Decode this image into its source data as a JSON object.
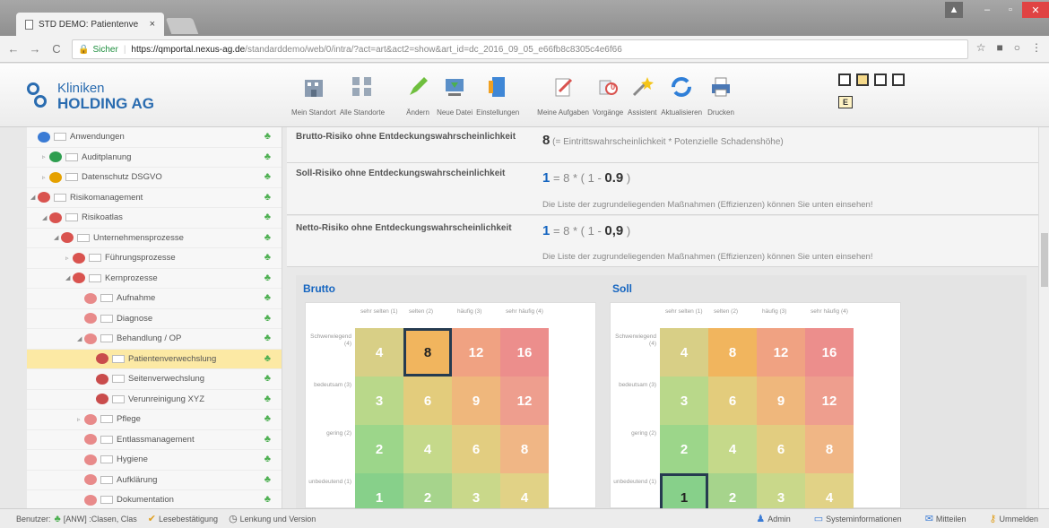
{
  "browser": {
    "tab_title": "STD DEMO: Patientenve",
    "tab_close": "×",
    "secure_label": "Sicher",
    "url_host": "https://qmportal.nexus-ag.de",
    "url_path": "/standarddemo/web/0/intra/?act=art&act2=show&art_id=dc_2016_09_05_e66fb8c8305c4e6f66"
  },
  "logo": {
    "line1": "Kliniken",
    "line2": "HOLDING AG"
  },
  "toolbar": {
    "mein_standort": "Mein Standort",
    "alle_standorte": "Alle Standorte",
    "aendern": "Ändern",
    "neue_datei": "Neue Datei",
    "einstellungen": "Einstellungen",
    "meine_aufgaben": "Meine Aufgaben",
    "vorgaenge": "Vorgänge",
    "vorgaenge_badge": "0",
    "assistent": "Assistent",
    "aktualisieren": "Aktualisieren",
    "drucken": "Drucken",
    "view_e": "E"
  },
  "sidebar": {
    "items": [
      {
        "label": "Anwendungen",
        "indent": 0,
        "tri": "",
        "icon": "#3a7bd5"
      },
      {
        "label": "Auditplanung",
        "indent": 1,
        "tri": "▹",
        "icon": "#2e9e4f"
      },
      {
        "label": "Datenschutz DSGVO",
        "indent": 1,
        "tri": "▹",
        "icon": "#e5a100"
      },
      {
        "label": "Risikomanagement",
        "indent": 0,
        "tri": "◢",
        "icon": "#d9534f"
      },
      {
        "label": "Risikoatlas",
        "indent": 1,
        "tri": "◢",
        "icon": "#d9534f"
      },
      {
        "label": "Unternehmensprozesse",
        "indent": 2,
        "tri": "◢",
        "icon": "#d9534f"
      },
      {
        "label": "Führungsprozesse",
        "indent": 3,
        "tri": "▹",
        "icon": "#d9534f"
      },
      {
        "label": "Kernprozesse",
        "indent": 3,
        "tri": "◢",
        "icon": "#d9534f"
      },
      {
        "label": "Aufnahme",
        "indent": 4,
        "tri": "",
        "icon": "#e88a8a"
      },
      {
        "label": "Diagnose",
        "indent": 4,
        "tri": "",
        "icon": "#e88a8a"
      },
      {
        "label": "Behandlung / OP",
        "indent": 4,
        "tri": "◢",
        "icon": "#e88a8a"
      },
      {
        "label": "Patientenverwechslung",
        "indent": 5,
        "tri": "",
        "icon": "#c94c4c",
        "selected": true
      },
      {
        "label": "Seitenverwechslung",
        "indent": 5,
        "tri": "",
        "icon": "#c94c4c"
      },
      {
        "label": "Verunreinigung XYZ",
        "indent": 5,
        "tri": "",
        "icon": "#c94c4c"
      },
      {
        "label": "Pflege",
        "indent": 4,
        "tri": "▹",
        "icon": "#e88a8a"
      },
      {
        "label": "Entlassmanagement",
        "indent": 4,
        "tri": "",
        "icon": "#e88a8a"
      },
      {
        "label": "Hygiene",
        "indent": 4,
        "tri": "",
        "icon": "#e88a8a"
      },
      {
        "label": "Aufklärung",
        "indent": 4,
        "tri": "",
        "icon": "#e88a8a"
      },
      {
        "label": "Dokumentation",
        "indent": 4,
        "tri": "",
        "icon": "#e88a8a"
      }
    ]
  },
  "risk": {
    "brutto_label": "Brutto-Risiko ohne Entdeckungswahrscheinlichkeit",
    "brutto_value": "8",
    "brutto_formula": "(= Eintrittswahrscheinlichkeit * Potenzielle Schadenshöhe)",
    "soll_label": "Soll-Risiko ohne Entdeckungswahrscheinlichkeit",
    "soll_value": "1",
    "soll_formula_a": " = 8 * ( 1 - ",
    "soll_factor": "0.9",
    "soll_formula_b": " )",
    "soll_note": "Die Liste der zugrundeliegenden Maßnahmen (Effizienzen) können Sie unten einsehen!",
    "netto_label": "Netto-Risiko ohne Entdeckungswahrscheinlichkeit",
    "netto_value": "1",
    "netto_formula_a": " = 8 * ( 1 - ",
    "netto_factor": "0,9",
    "netto_formula_b": " )",
    "netto_note": "Die Liste der zugrundeliegenden Maßnahmen (Effizienzen) können Sie unten einsehen!"
  },
  "matrix": {
    "brutto_title": "Brutto",
    "soll_title": "Soll",
    "columns": [
      "sehr selten\n(1)",
      "selten\n(2)",
      "häufig\n(3)",
      "sehr häufig\n(4)"
    ],
    "rows": [
      "Schwerwiegend\n(4)",
      "bedeutsam\n(3)",
      "gering\n(2)",
      "unbedeutend\n(1)"
    ],
    "values": [
      [
        4,
        8,
        12,
        16
      ],
      [
        3,
        6,
        9,
        12
      ],
      [
        2,
        4,
        6,
        8
      ],
      [
        1,
        2,
        3,
        4
      ]
    ],
    "colors": [
      [
        "#d8cf86",
        "#f1b55e",
        "#f0a282",
        "#ec8e8c"
      ],
      [
        "#b9d88a",
        "#e3cc7c",
        "#efb77c",
        "#ee9e8e"
      ],
      [
        "#9cd68a",
        "#c5d98a",
        "#e2cd80",
        "#f0b685"
      ],
      [
        "#87d08a",
        "#a6d48c",
        "#c9d88a",
        "#e1d286"
      ]
    ],
    "brutto_highlight": 8,
    "soll_highlight": 1
  },
  "status": {
    "benutzer_label": "Benutzer:",
    "user": "[ANW] :Clasen, Clas",
    "lesebestaetigung": "Lesebestätigung",
    "lenkung": "Lenkung und Version",
    "admin": "Admin",
    "systeminfo": "Systeminformationen",
    "mitteilen": "Mitteilen",
    "ummelden": "Ummelden"
  }
}
